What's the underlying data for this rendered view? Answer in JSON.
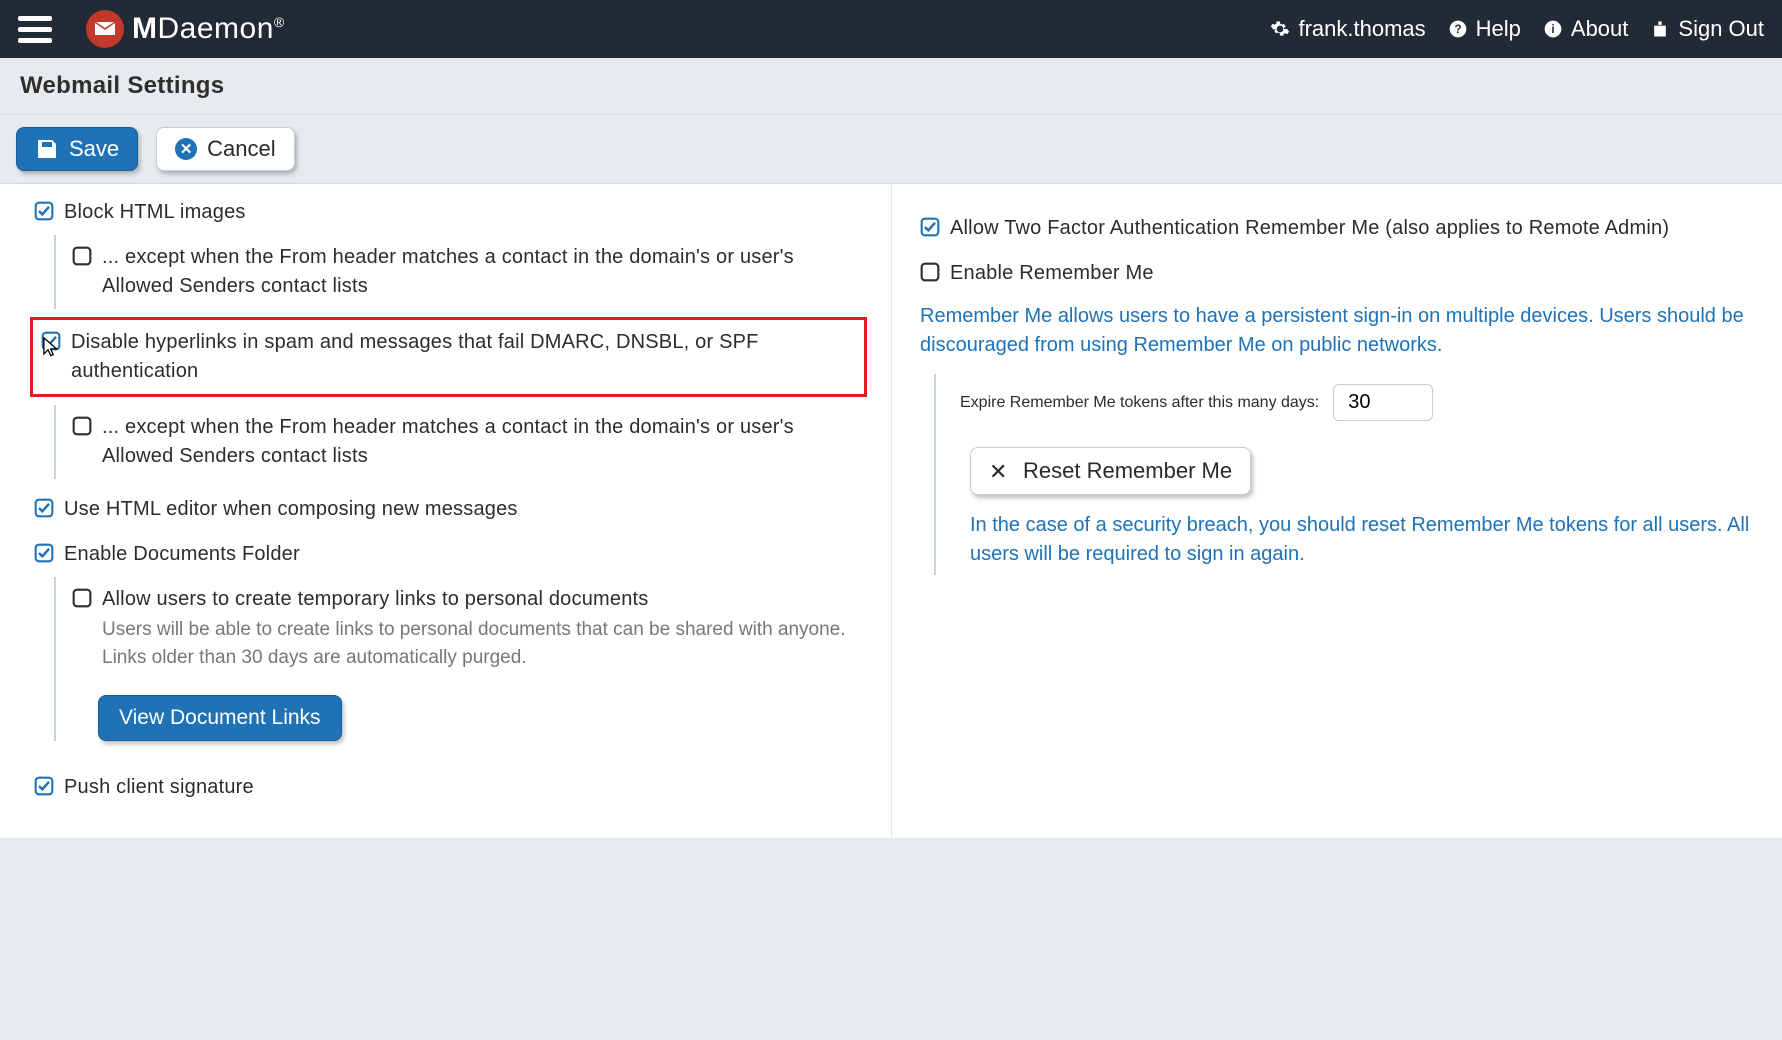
{
  "topbar": {
    "product": "MDaemon®",
    "user": "frank.thomas",
    "help": "Help",
    "about": "About",
    "signout": "Sign Out"
  },
  "page_title": "Webmail Settings",
  "toolbar": {
    "save": "Save",
    "cancel": "Cancel"
  },
  "left": {
    "block_html_images": "Block HTML images",
    "except_from_contacts": "... except when the From header matches a contact in the domain's or user's Allowed Senders contact lists",
    "disable_hyperlinks": "Disable hyperlinks in spam and messages that fail DMARC, DNSBL, or SPF authentication",
    "use_html_editor": "Use HTML editor when composing new messages",
    "enable_documents_folder": "Enable Documents Folder",
    "allow_temp_links": "Allow users to create temporary links to personal documents",
    "allow_temp_links_desc": "Users will be able to create links to personal documents that can be shared with anyone. Links older than 30 days are automatically purged.",
    "view_document_links": "View Document Links",
    "push_client_signature": "Push client signature"
  },
  "right": {
    "allow_2fa_remember": "Allow Two Factor Authentication Remember Me (also applies to Remote Admin)",
    "enable_remember_me": "Enable Remember Me",
    "remember_me_info": "Remember Me allows users to have a persistent sign-in on multiple devices. Users should be discouraged from using Remember Me on public networks.",
    "expire_label": "Expire Remember Me tokens after this many days:",
    "expire_value": "30",
    "reset_remember_me": "Reset Remember Me",
    "reset_info": "In the case of a security breach, you should reset Remember Me tokens for all users. All users will be required to sign in again."
  }
}
